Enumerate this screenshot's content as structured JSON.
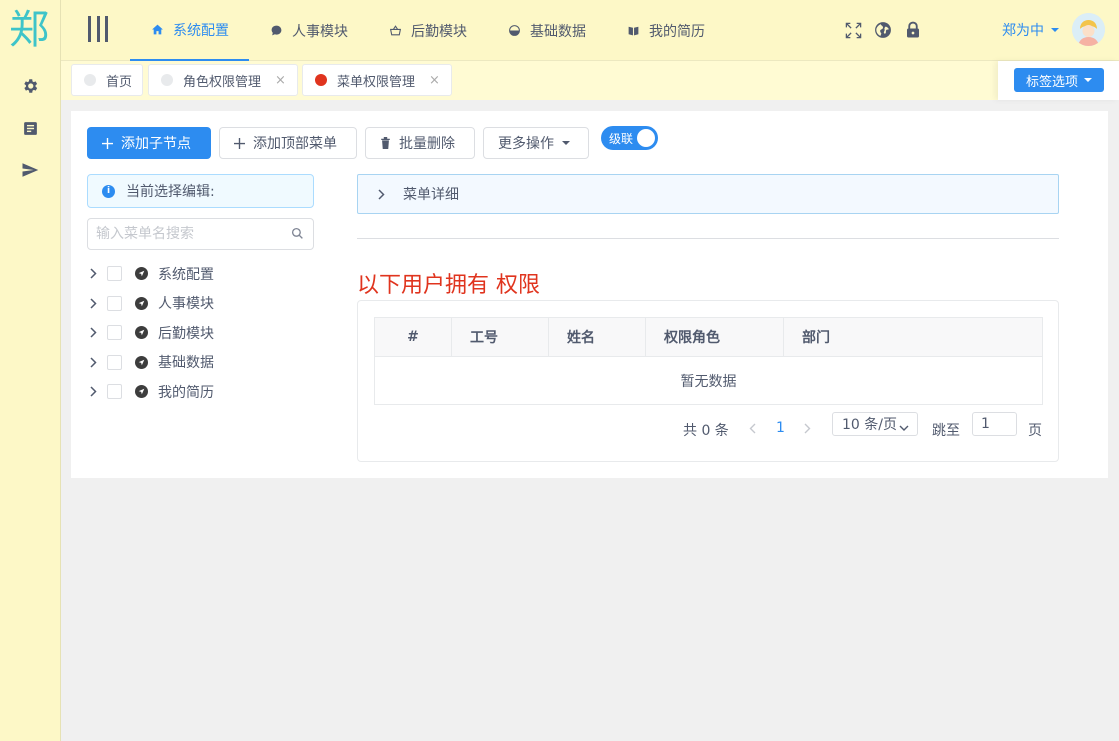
{
  "logo": {
    "char": "郑"
  },
  "header": {
    "nav": [
      {
        "label": "系统配置",
        "icon": "home-icon",
        "active": true
      },
      {
        "label": "人事模块",
        "icon": "chat-icon"
      },
      {
        "label": "后勤模块",
        "icon": "basket-icon"
      },
      {
        "label": "基础数据",
        "icon": "pie-icon"
      },
      {
        "label": "我的简历",
        "icon": "book-icon"
      }
    ],
    "tools": [
      "fullscreen-icon",
      "globe-icon",
      "lock-icon"
    ],
    "user_name": "郑为中"
  },
  "tabs": {
    "items": [
      {
        "label": "首页",
        "closable": false,
        "active": false
      },
      {
        "label": "角色权限管理",
        "closable": true,
        "active": false
      },
      {
        "label": "菜单权限管理",
        "closable": true,
        "active": true
      }
    ],
    "close_glyph": "×",
    "options_label": "标签选项"
  },
  "toolbar": {
    "add_child_label": "添加子节点",
    "add_top_label": "添加顶部菜单",
    "batch_delete_label": "批量删除",
    "more_label": "更多操作",
    "cascade_label": "级联"
  },
  "alert": {
    "text": "当前选择编辑:"
  },
  "search": {
    "placeholder": "输入菜单名搜索"
  },
  "tree": {
    "nodes": [
      {
        "label": "系统配置"
      },
      {
        "label": "人事模块"
      },
      {
        "label": "后勤模块"
      },
      {
        "label": "基础数据"
      },
      {
        "label": "我的简历"
      }
    ]
  },
  "detail": {
    "collapse_label": "菜单详细",
    "users_title": "以下用户拥有 权限"
  },
  "table": {
    "columns": [
      "#",
      "工号",
      "姓名",
      "权限角色",
      "部门"
    ],
    "rows": [],
    "empty_text": "暂无数据"
  },
  "pagination": {
    "total_text": "共 0 条",
    "current_page": "1",
    "page_size": "10 条/页",
    "jump_label": "跳至",
    "jump_value": "1",
    "page_suffix": "页"
  },
  "colors": {
    "primary": "#2d8cf0",
    "header_bg": "#fdf8c7",
    "logo": "#3ec4c9",
    "danger_title": "#e0341e"
  }
}
